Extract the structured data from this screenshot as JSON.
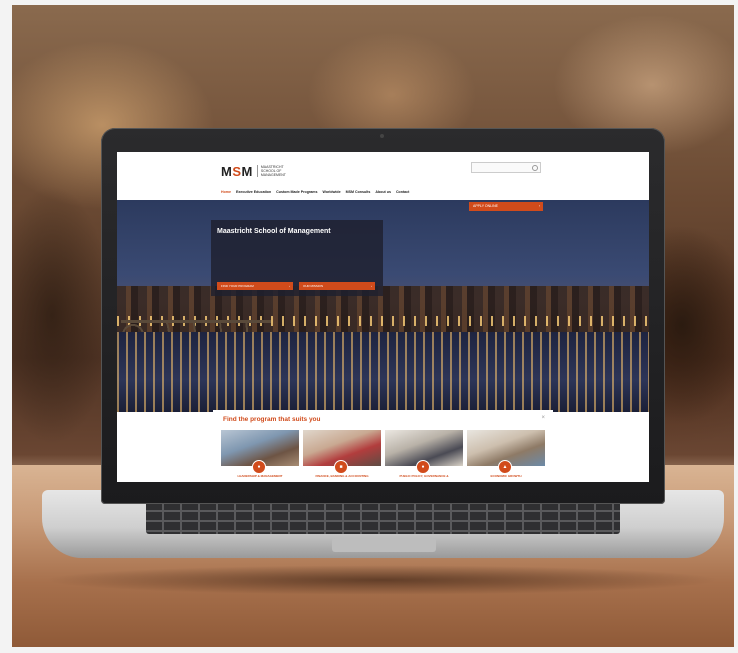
{
  "site": {
    "logo_mark": "MSM",
    "logo_text": "Maastricht School of Management",
    "nav": [
      "Home",
      "Executive Education",
      "Custom Made Programs",
      "Worldwide",
      "MSM Consults",
      "About us",
      "Contact"
    ],
    "apply_label": "APPLY ONLINE",
    "hero": {
      "title": "Maastricht School of Management",
      "buttons": [
        "FIND YOUR PROGRAM",
        "OUR MISSION"
      ]
    },
    "finder": {
      "title": "Find the program that suits you",
      "cards": [
        {
          "label": "LEADERSHIP & MANAGEMENT"
        },
        {
          "label": "FINANCE, BANKING & ACCOUNTING"
        },
        {
          "label": "PUBLIC POLICY, GOVERNANCE & "
        },
        {
          "label": "ECONOMIC GROWTH"
        }
      ]
    }
  },
  "colors": {
    "accent": "#d14b1b",
    "laptop_bezel": "#1f1f21",
    "table_wood": "#c89a77"
  },
  "icons": {
    "search": "magnifier-icon",
    "arrow": "chevron-right-icon",
    "close": "close-icon",
    "card_badges": [
      "person-icon",
      "briefcase-icon",
      "person-icon",
      "thumbs-up-icon"
    ]
  }
}
